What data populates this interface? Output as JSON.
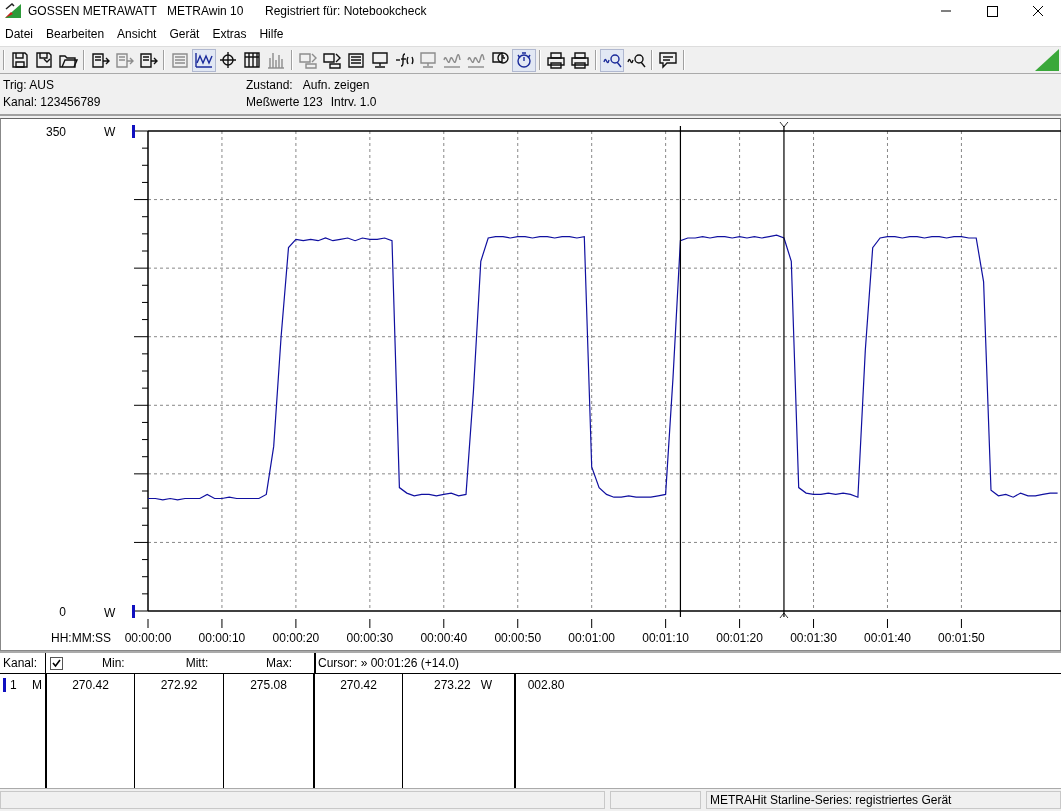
{
  "window": {
    "app_name": "GOSSEN METRAWATT",
    "program": "METRAwin 10",
    "registered": "Registriert für: Notebookcheck"
  },
  "menu": [
    {
      "label": "Datei"
    },
    {
      "label": "Bearbeiten"
    },
    {
      "label": "Ansicht"
    },
    {
      "label": "Gerät"
    },
    {
      "label": "Extras"
    },
    {
      "label": "Hilfe"
    }
  ],
  "toolbar_groups": [
    {
      "buttons": [
        {
          "kind": "save",
          "disabled": false,
          "pressed": false
        },
        {
          "kind": "save-as",
          "disabled": false,
          "pressed": false
        },
        {
          "kind": "open",
          "disabled": false,
          "pressed": false
        }
      ]
    },
    {
      "buttons": [
        {
          "kind": "export",
          "disabled": false,
          "pressed": false
        },
        {
          "kind": "export",
          "disabled": true,
          "pressed": false
        },
        {
          "kind": "export",
          "disabled": false,
          "pressed": false
        }
      ]
    },
    {
      "buttons": [
        {
          "kind": "list",
          "disabled": true,
          "pressed": false
        },
        {
          "kind": "line-chart",
          "disabled": false,
          "pressed": true
        },
        {
          "kind": "crosshair",
          "disabled": false,
          "pressed": false
        },
        {
          "kind": "table",
          "disabled": false,
          "pressed": false
        },
        {
          "kind": "bars",
          "disabled": true,
          "pressed": false
        }
      ]
    },
    {
      "buttons": [
        {
          "kind": "transfer",
          "disabled": true,
          "pressed": false
        },
        {
          "kind": "transfer",
          "disabled": false,
          "pressed": false
        },
        {
          "kind": "list",
          "disabled": false,
          "pressed": false
        },
        {
          "kind": "monitor",
          "disabled": false,
          "pressed": false
        },
        {
          "kind": "formula",
          "disabled": false,
          "pressed": false
        },
        {
          "kind": "monitor",
          "disabled": true,
          "pressed": false
        },
        {
          "kind": "wave",
          "disabled": true,
          "pressed": false
        },
        {
          "kind": "wave",
          "disabled": true,
          "pressed": false
        },
        {
          "kind": "clock",
          "disabled": false,
          "pressed": false
        },
        {
          "kind": "stopwatch",
          "disabled": false,
          "pressed": true
        }
      ]
    },
    {
      "buttons": [
        {
          "kind": "print",
          "disabled": false,
          "pressed": false
        },
        {
          "kind": "print",
          "disabled": false,
          "pressed": false
        }
      ]
    },
    {
      "buttons": [
        {
          "kind": "zoom",
          "disabled": false,
          "pressed": true
        },
        {
          "kind": "zoom",
          "disabled": false,
          "pressed": false
        }
      ]
    },
    {
      "buttons": [
        {
          "kind": "comment",
          "disabled": false,
          "pressed": false
        }
      ]
    }
  ],
  "info": {
    "trigger": "Trig: AUS",
    "channels": "Kanal: 123456789",
    "state_label": "Zustand:",
    "state_value": "Aufn. zeigen",
    "count": "Meßwerte 123",
    "interval": "Intrv. 1.0"
  },
  "chart": {
    "unit_top": "W",
    "unit_bottom": "W",
    "time_format": "HH:MM:SS",
    "chart_data": {
      "type": "line",
      "grid": true,
      "xlim": [
        0,
        123.6
      ],
      "ylim": [
        0,
        350
      ],
      "yticks": [
        {
          "value": 0,
          "label": "0"
        },
        {
          "value": 350,
          "label": "350"
        }
      ],
      "xticks": [
        {
          "value": 0,
          "label": "00:00:00"
        },
        {
          "value": 10,
          "label": "00:00:10"
        },
        {
          "value": 20,
          "label": "00:00:20"
        },
        {
          "value": 30,
          "label": "00:00:30"
        },
        {
          "value": 40,
          "label": "00:00:40"
        },
        {
          "value": 50,
          "label": "00:00:50"
        },
        {
          "value": 60,
          "label": "00:01:00"
        },
        {
          "value": 70,
          "label": "00:01:10"
        },
        {
          "value": 80,
          "label": "00:01:20"
        },
        {
          "value": 90,
          "label": "00:01:30"
        },
        {
          "value": 100,
          "label": "00:01:40"
        },
        {
          "value": 110,
          "label": "00:01:50"
        }
      ],
      "x": [
        0,
        1,
        2,
        3,
        4,
        5,
        6,
        7,
        8,
        9,
        10,
        11,
        12,
        13,
        14,
        15,
        16,
        17,
        18,
        19,
        20,
        21,
        22,
        23,
        24,
        25,
        26,
        27,
        28,
        29,
        30,
        31,
        32,
        33,
        34,
        35,
        36,
        37,
        38,
        39,
        40,
        41,
        42,
        43,
        44,
        45,
        46,
        47,
        48,
        49,
        50,
        51,
        52,
        53,
        54,
        55,
        56,
        57,
        58,
        59,
        60,
        61,
        62,
        63,
        64,
        65,
        66,
        67,
        68,
        69,
        70,
        71,
        72,
        73,
        74,
        75,
        76,
        77,
        78,
        79,
        80,
        81,
        82,
        83,
        84,
        85,
        86,
        87,
        88,
        89,
        90,
        91,
        92,
        93,
        94,
        95,
        96,
        97,
        98,
        99,
        100,
        101,
        102,
        103,
        104,
        105,
        106,
        107,
        108,
        109,
        110,
        111,
        112,
        113,
        114,
        115,
        116,
        117,
        118,
        119,
        120,
        121,
        122,
        123
      ],
      "series": [
        {
          "color": "#1010a0",
          "values": [
            82,
            82,
            81,
            82,
            81,
            82,
            82,
            82,
            85,
            82,
            82,
            83,
            82,
            82,
            82,
            82,
            85,
            120,
            200,
            265,
            271,
            270,
            271,
            270,
            272,
            270,
            271,
            272,
            270,
            272,
            271,
            271,
            272,
            270,
            90,
            86,
            84,
            85,
            85,
            84,
            85,
            86,
            84,
            85,
            160,
            255,
            272,
            273,
            273,
            272,
            273,
            273,
            272,
            273,
            273,
            272,
            273,
            273,
            272,
            273,
            105,
            90,
            85,
            83,
            83,
            84,
            83,
            83,
            83,
            84,
            85,
            170,
            270,
            272,
            272,
            273,
            272,
            273,
            273,
            272,
            273,
            272,
            273,
            272,
            273,
            274,
            272,
            255,
            90,
            86,
            85,
            85,
            86,
            85,
            86,
            85,
            83,
            190,
            265,
            272,
            273,
            273,
            272,
            273,
            273,
            272,
            273,
            273,
            272,
            273,
            273,
            272,
            272,
            240,
            88,
            84,
            85,
            83,
            86,
            84,
            84,
            85,
            86,
            86
          ]
        }
      ],
      "ref_lines": [
        {
          "axis": "x",
          "value": 72
        },
        {
          "axis": "x",
          "value": 86
        }
      ]
    }
  },
  "table": {
    "channel_header": "Kanal:",
    "all_checked": true,
    "columns": [
      "Min:",
      "Mitt:",
      "Max:"
    ],
    "cursor_header": "Cursor: » 00:01:26 (+14.0)",
    "rows": [
      {
        "channel": "1",
        "mode": "M",
        "min": "270.42",
        "mean": "272.92",
        "max": "275.08",
        "cursor_a": "270.42",
        "cursor_b": "273.22",
        "unit": "W",
        "delta": "002.80"
      }
    ]
  },
  "status_bar": {
    "message": "METRAHit Starline-Series: registriertes Gerät"
  }
}
